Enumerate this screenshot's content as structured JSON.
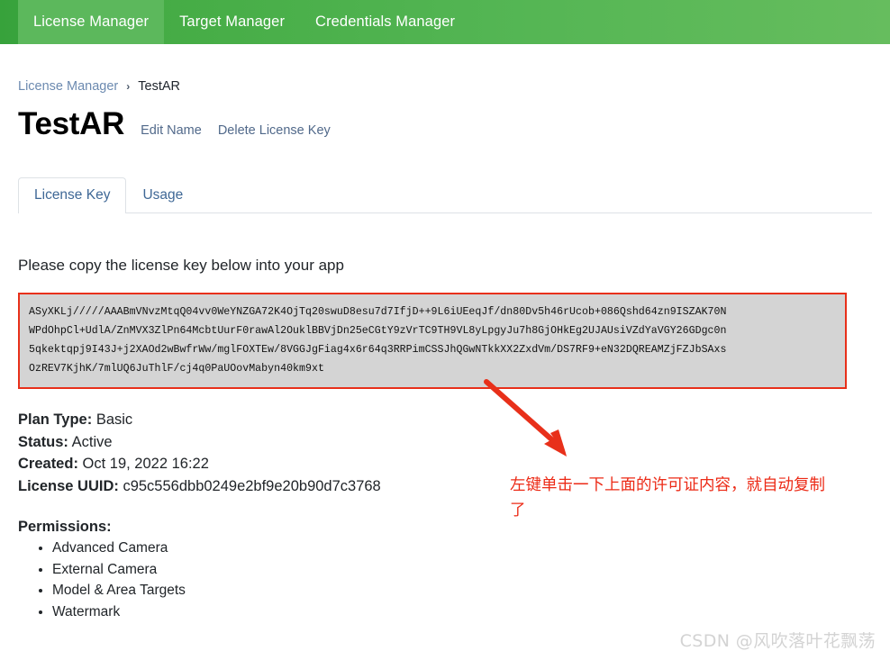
{
  "navbar": {
    "items": [
      {
        "label": "License Manager",
        "active": true
      },
      {
        "label": "Target Manager",
        "active": false
      },
      {
        "label": "Credentials Manager",
        "active": false
      }
    ]
  },
  "breadcrumb": {
    "parent": "License Manager",
    "separator": "›",
    "current": "TestAR"
  },
  "header": {
    "title": "TestAR",
    "edit_name_label": "Edit Name",
    "delete_label": "Delete License Key"
  },
  "tabs": [
    {
      "label": "License Key",
      "active": true
    },
    {
      "label": "Usage",
      "active": false
    }
  ],
  "main": {
    "instruction": "Please copy the license key below into your app",
    "license_key_lines": [
      "ASyXKLj/////AAABmVNvzMtqQ04vv0WeYNZGA72K4OjTq20swuD8esu7d7IfjD++9L6iUEeqJf/dn80Dv5h46rUcob+086Qshd64zn9ISZAK70N",
      "WPdOhpCl+UdlA/ZnMVX3ZlPn64McbtUurF0rawAl2OuklBBVjDn25eCGtY9zVrTC9TH9VL8yLpgyJu7h8GjOHkEg2UJAUsiVZdYaVGY26GDgc0n",
      "5qkektqpj9I43J+j2XAOd2wBwfrWw/mglFOXTEw/8VGGJgFiag4x6r64q3RRPimCSSJhQGwNTkkXX2ZxdVm/DS7RF9+eN32DQREAMZjFZJbSAxs",
      "OzREV7KjhK/7mlUQ6JuThlF/cj4q0PaUOovMabyn40km9xt"
    ],
    "details": [
      {
        "label": "Plan Type:",
        "value": "Basic"
      },
      {
        "label": "Status:",
        "value": "Active"
      },
      {
        "label": "Created:",
        "value": "Oct 19, 2022 16:22"
      },
      {
        "label": "License UUID:",
        "value": "c95c556dbb0249e2bf9e20b90d7c3768"
      }
    ],
    "permissions_heading": "Permissions:",
    "permissions": [
      "Advanced Camera",
      "External Camera",
      "Model & Area Targets",
      "Watermark"
    ]
  },
  "annotation": {
    "text": "左键单击一下上面的许可证内容，就自动复制了",
    "color": "#ec2a16"
  },
  "watermark": {
    "text": "CSDN @风吹落叶花飘荡"
  },
  "colors": {
    "navbar_green": "#53b553",
    "active_tab_green": "#5cb85c",
    "key_box_border": "#e8301a",
    "key_box_background": "#d4d4d4",
    "link_blue": "#51698a"
  }
}
